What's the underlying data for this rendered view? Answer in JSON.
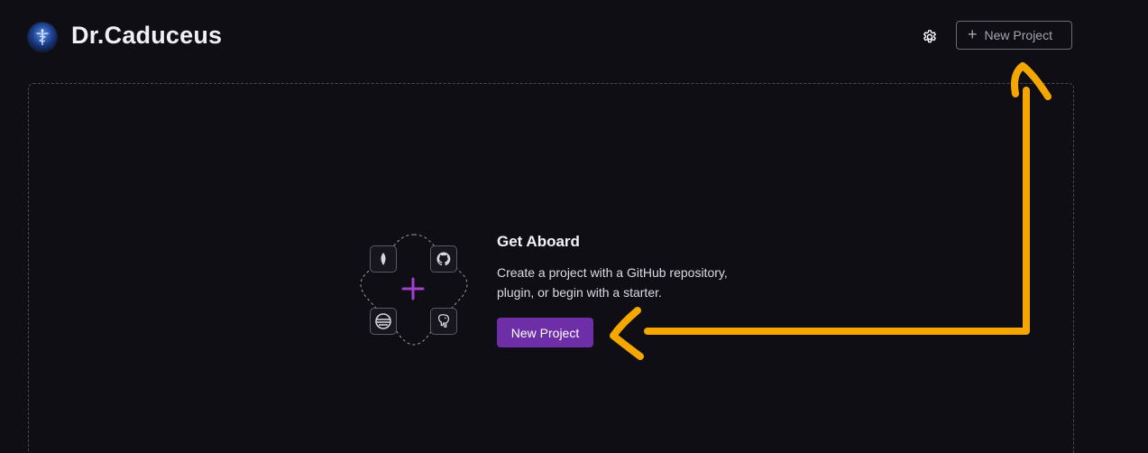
{
  "header": {
    "brand": "Dr.Caduceus",
    "settings_icon": "gear-icon",
    "new_project_label": "New Project",
    "new_project_icon": "plus-icon"
  },
  "empty_state": {
    "title": "Get Aboard",
    "description_line1": "Create a project with a GitHub repository,",
    "description_line2": "plugin, or begin with a starter.",
    "cta_label": "New Project",
    "illustration_icons": [
      "mongodb-leaf-icon",
      "github-icon",
      "mysql-dolphin-icon",
      "postgresql-elephant-icon"
    ]
  },
  "colors": {
    "background": "#0f0e15",
    "accent": "#6d2ea8",
    "plus_accent": "#a43fc9",
    "annotation": "#f5a700"
  }
}
